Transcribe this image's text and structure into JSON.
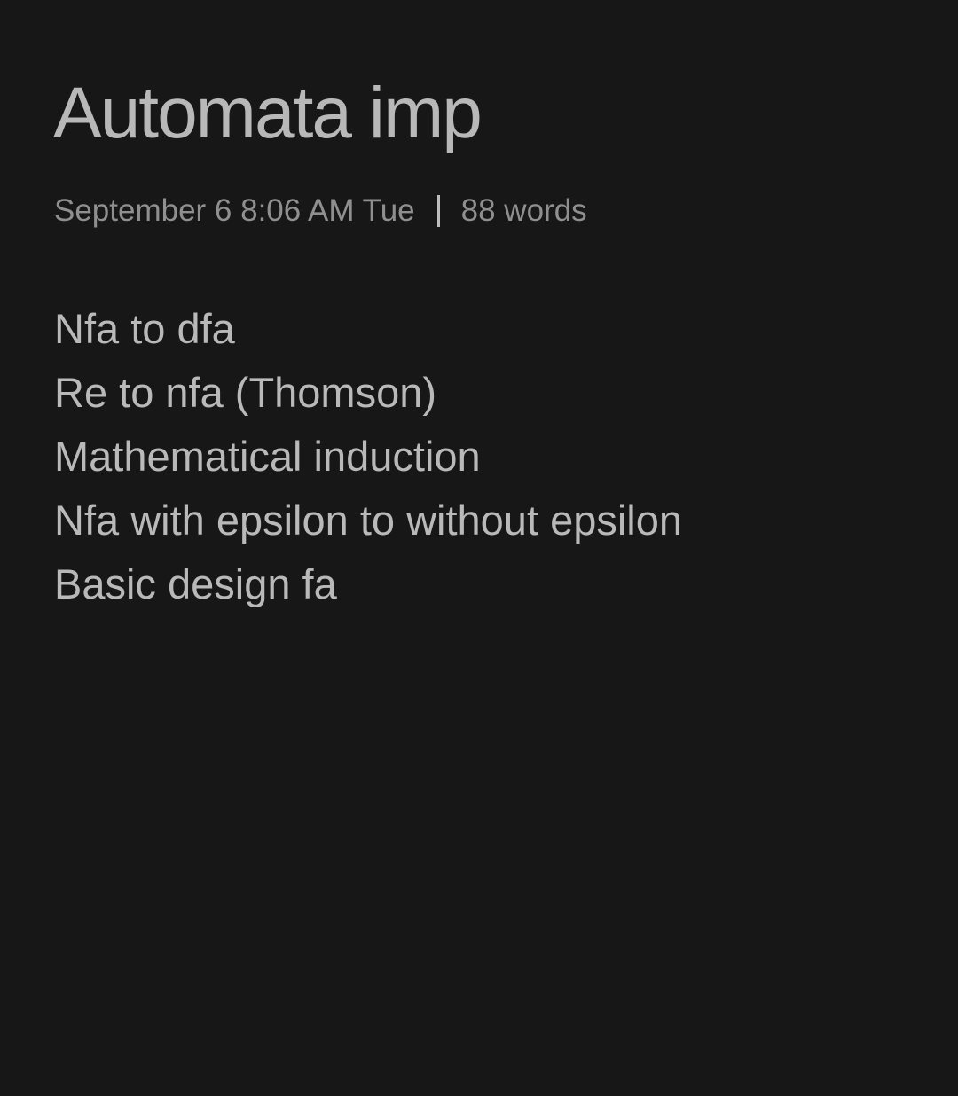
{
  "note": {
    "title": "Automata imp",
    "date": "September 6 8:06 AM Tue",
    "word_count": "88 words",
    "lines": [
      "Nfa to dfa",
      "Re to nfa (Thomson)",
      "Mathematical induction",
      "Nfa with epsilon to without epsilon",
      "Basic design fa"
    ]
  },
  "colors": {
    "background": "#171717",
    "title": "#b8b8b8",
    "meta": "#8f8f8f",
    "body_text": "#b9b9b9"
  }
}
